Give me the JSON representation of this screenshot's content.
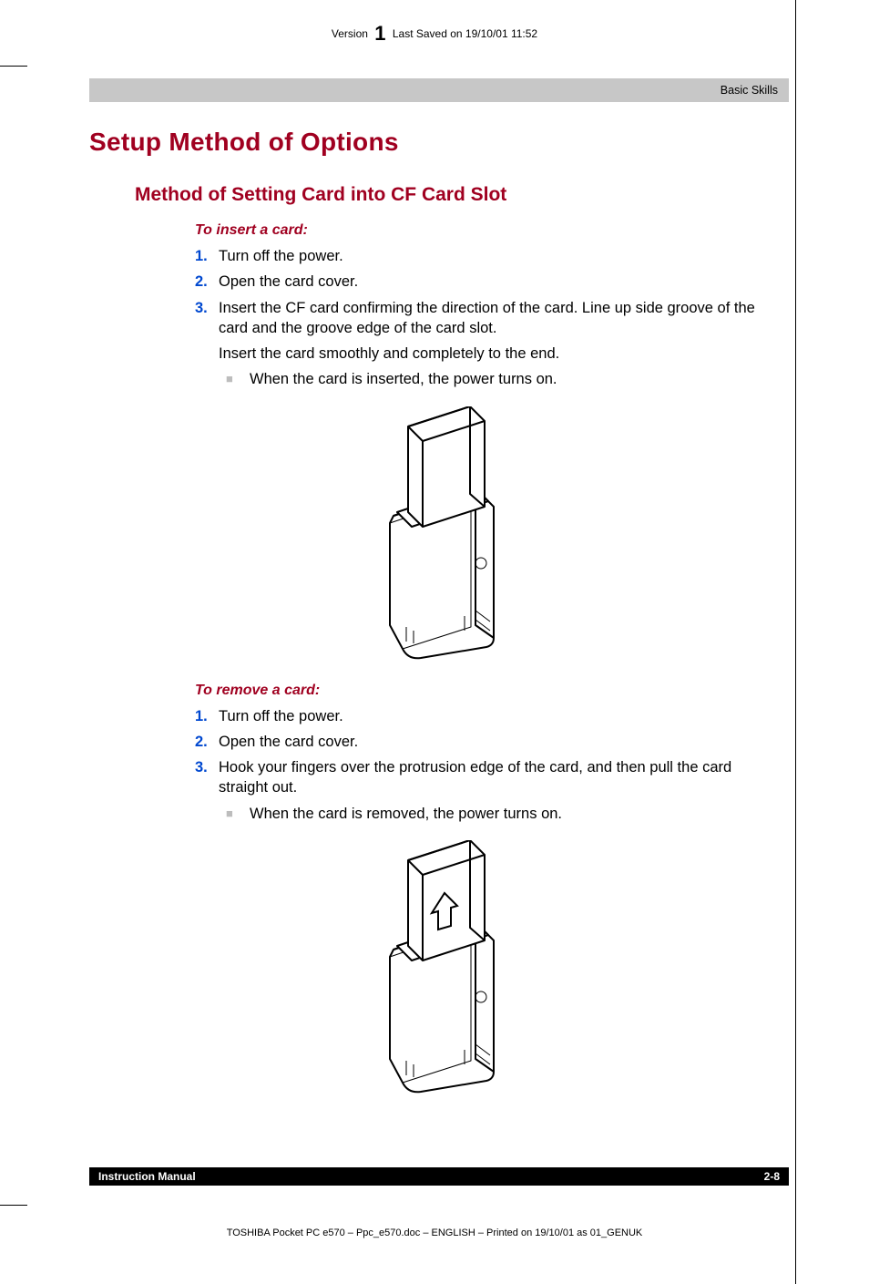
{
  "header": {
    "version_label": "Version",
    "version_number": "1",
    "last_saved": "Last Saved on 19/10/01 11:52"
  },
  "section_bar": "Basic Skills",
  "title": "Setup Method of Options",
  "subtitle": "Method of Setting Card into CF Card Slot",
  "insert": {
    "heading": "To insert a card:",
    "steps": [
      {
        "n": "1.",
        "t": "Turn off the power."
      },
      {
        "n": "2.",
        "t": "Open the card cover."
      },
      {
        "n": "3.",
        "t": "Insert the CF card confirming the direction of the card. Line up side groove of the card and the groove edge of the card slot."
      }
    ],
    "step3_cont": "Insert the card smoothly and completely to the end.",
    "bullet": "When the card is inserted, the power turns on."
  },
  "remove": {
    "heading": "To remove a card:",
    "steps": [
      {
        "n": "1.",
        "t": "Turn off the power."
      },
      {
        "n": "2.",
        "t": "Open the card cover."
      },
      {
        "n": "3.",
        "t": "Hook your fingers over the protrusion edge of the card, and then pull the card straight out."
      }
    ],
    "bullet": "When the card is removed, the power turns on."
  },
  "footer_bar": {
    "left": "Instruction Manual",
    "right": "2-8"
  },
  "footer_line": "TOSHIBA Pocket PC e570  – Ppc_e570.doc – ENGLISH – Printed on 19/10/01 as 01_GENUK"
}
